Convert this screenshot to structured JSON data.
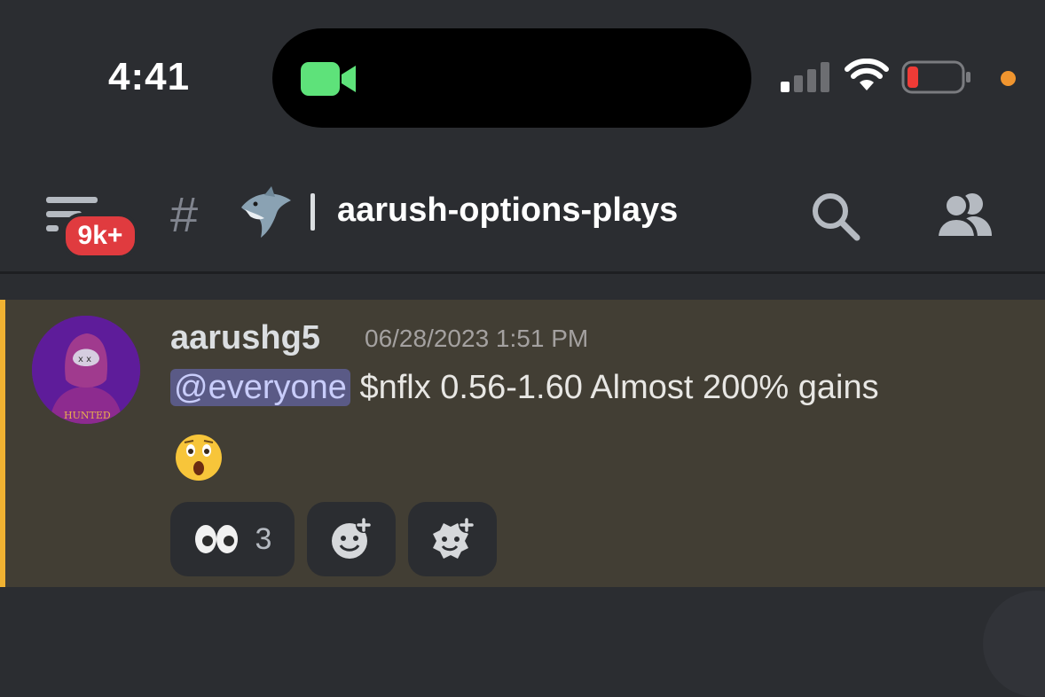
{
  "status_bar": {
    "time": "4:41"
  },
  "header": {
    "badge": "9k+",
    "hash": "#",
    "channel_name": "aarush-options-plays"
  },
  "message": {
    "author": "aarushg5",
    "timestamp": "06/28/2023 1:51 PM",
    "mention": "@everyone",
    "text": "$nflx 0.56-1.60 Almost 200% gains",
    "reactions": [
      {
        "emoji": "eyes-emoji",
        "count": "3"
      },
      {
        "emoji": "add-reaction-icon"
      },
      {
        "emoji": "add-super-reaction-icon"
      }
    ]
  },
  "colors": {
    "accent_bar": "#f0b232",
    "badge": "#e03b3f",
    "mention_bg": "#5a5a86",
    "camera": "#5ee27a"
  }
}
